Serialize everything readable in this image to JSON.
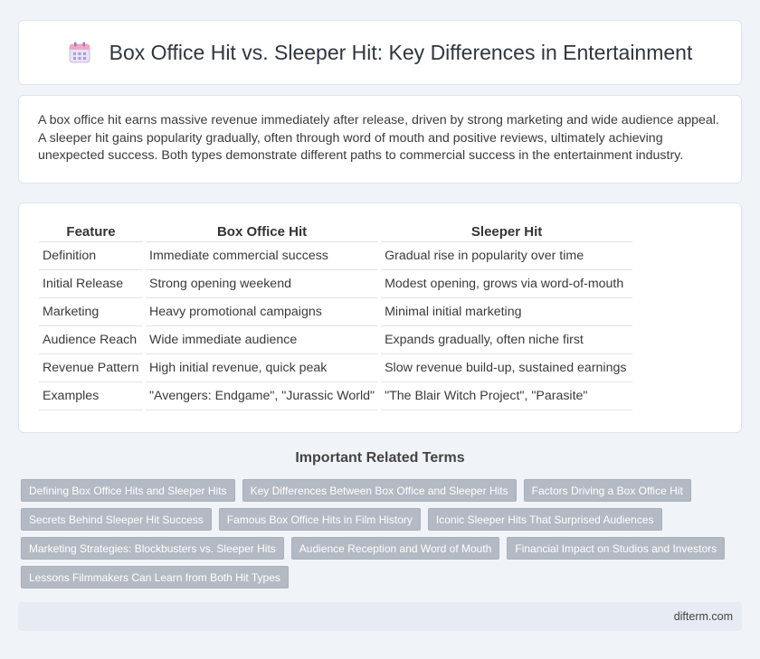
{
  "header": {
    "icon": "calendar-icon",
    "title": "Box Office Hit vs. Sleeper Hit: Key Differences in Entertainment"
  },
  "intro": {
    "text": "A box office hit earns massive revenue immediately after release, driven by strong marketing and wide audience appeal. A sleeper hit gains popularity gradually, often through word of mouth and positive reviews, ultimately achieving unexpected success. Both types demonstrate different paths to commercial success in the entertainment industry."
  },
  "table": {
    "headers": [
      "Feature",
      "Box Office Hit",
      "Sleeper Hit"
    ],
    "rows": [
      [
        "Definition",
        "Immediate commercial success",
        "Gradual rise in popularity over time"
      ],
      [
        "Initial Release",
        "Strong opening weekend",
        "Modest opening, grows via word-of-mouth"
      ],
      [
        "Marketing",
        "Heavy promotional campaigns",
        "Minimal initial marketing"
      ],
      [
        "Audience Reach",
        "Wide immediate audience",
        "Expands gradually, often niche first"
      ],
      [
        "Revenue Pattern",
        "High initial revenue, quick peak",
        "Slow revenue build-up, sustained earnings"
      ],
      [
        "Examples",
        "\"Avengers: Endgame\", \"Jurassic World\"",
        "\"The Blair Witch Project\", \"Parasite\""
      ]
    ]
  },
  "related": {
    "heading": "Important Related Terms",
    "tags": [
      "Defining Box Office Hits and Sleeper Hits",
      "Key Differences Between Box Office and Sleeper Hits",
      "Factors Driving a Box Office Hit",
      "Secrets Behind Sleeper Hit Success",
      "Famous Box Office Hits in Film History",
      "Iconic Sleeper Hits That Surprised Audiences",
      "Marketing Strategies: Blockbusters vs. Sleeper Hits",
      "Audience Reception and Word of Mouth",
      "Financial Impact on Studios and Investors",
      "Lessons Filmmakers Can Learn from Both Hit Types"
    ]
  },
  "footer": {
    "site": "difterm.com"
  },
  "colors": {
    "background": "#f0f3f8",
    "tag": "#b4bac3",
    "footer": "#e6ebf4"
  }
}
